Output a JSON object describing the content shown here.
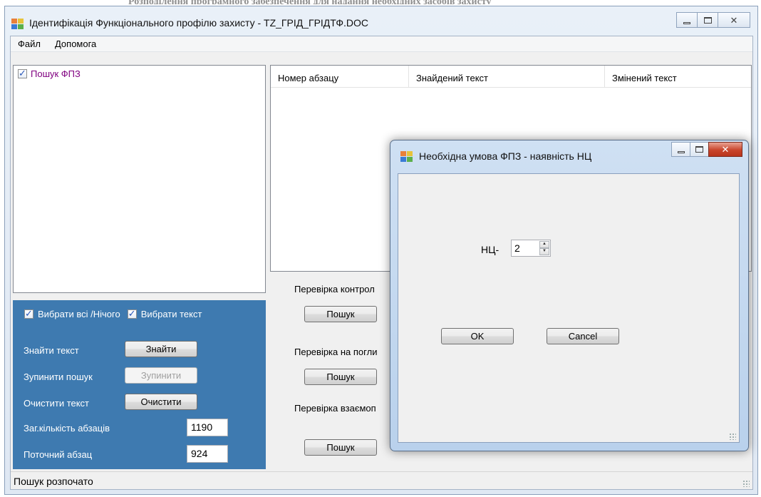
{
  "background_text": "Розподілення програмного забезпечення для надання необхідних засобів захисту",
  "main_window": {
    "title": "Ідентифікація Функціонального профілю захисту - TZ_ГРІД_ГРІДТФ.DOC"
  },
  "menu": {
    "items": [
      "Файл",
      "Допомога"
    ]
  },
  "tree": {
    "root_label": "Пошук ФПЗ"
  },
  "options": {
    "select_all_label": "Вибрати всі /Нічого",
    "select_text_label": "Вибрати текст",
    "find_text_label": "Знайти текст",
    "find_button": "Знайти",
    "stop_search_label": "Зупинити пошук",
    "stop_button": "Зупинити",
    "clear_text_label": "Очистити текст",
    "clear_button": "Очистити",
    "total_paragraphs_label": "Заг.кількість абзаців",
    "total_paragraphs_value": "1190",
    "current_paragraph_label": "Поточний абзац",
    "current_paragraph_value": "924"
  },
  "grid": {
    "columns": [
      "Номер абзацу",
      "Знайдений текст",
      "Змінений текст"
    ]
  },
  "checks": {
    "control_label": "Перевірка контрол",
    "absorb_label": "Перевірка на погли",
    "mutual_label": "Перевірка взаємоп",
    "search_button": "Пошук"
  },
  "status": {
    "text": "Пошук розпочато"
  },
  "dialog": {
    "title": "Необхідна умова ФПЗ - наявність НЦ",
    "nc_label": "НЦ-",
    "nc_value": "2",
    "ok_button": "OK",
    "cancel_button": "Cancel"
  }
}
